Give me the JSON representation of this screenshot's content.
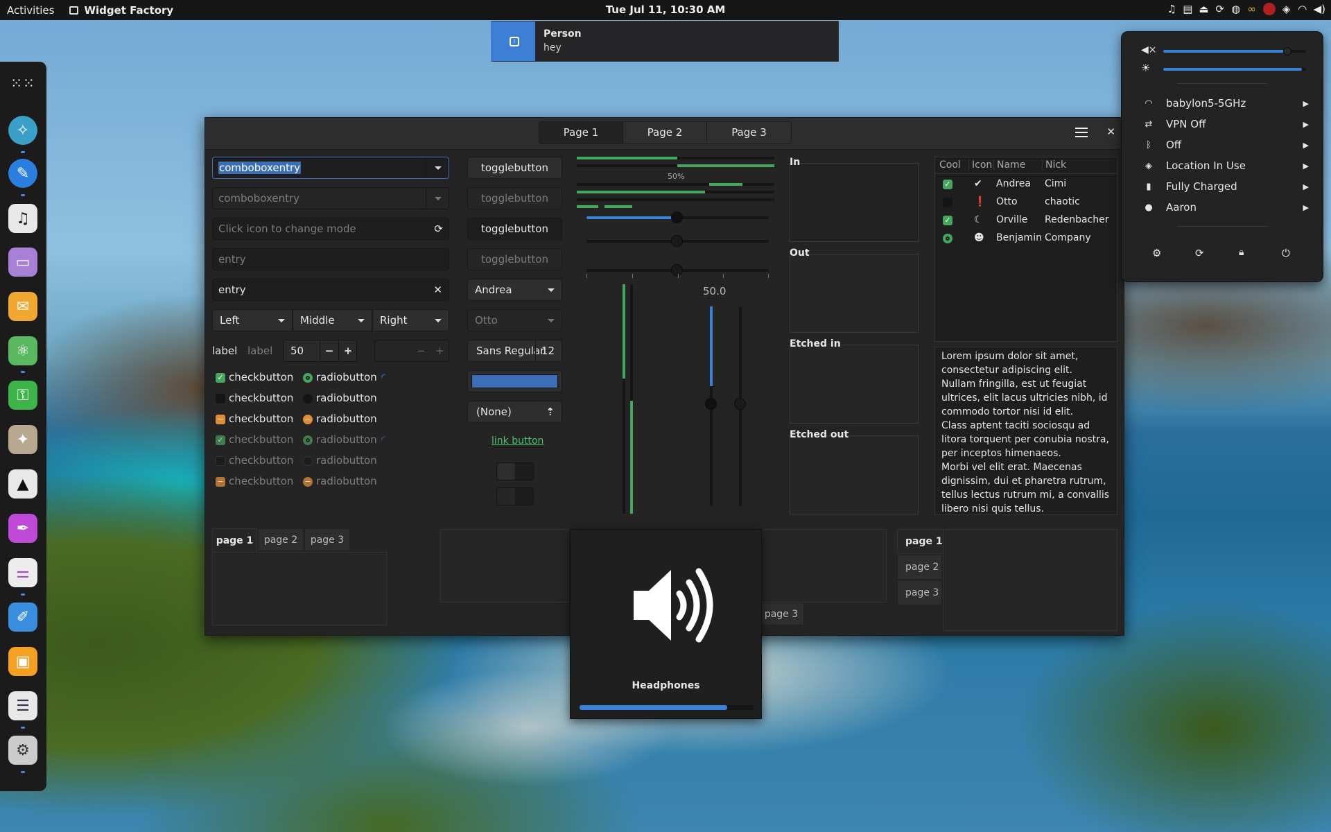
{
  "topbar": {
    "activities": "Activities",
    "app_name": "Widget Factory",
    "clock": "Tue Jul 11, 10:30 AM",
    "tray_icons": [
      "music-icon",
      "clipboard-icon",
      "eject-icon",
      "refresh-icon",
      "steam-icon",
      "chain-icon",
      "avatar-icon",
      "location-icon",
      "wifi-icon",
      "volume-icon"
    ]
  },
  "notification": {
    "title": "Person",
    "body": "hey"
  },
  "header": {
    "pages": [
      "Page 1",
      "Page 2",
      "Page 3"
    ]
  },
  "entries": {
    "combo1": "comboboxentry",
    "combo2": "comboboxentry",
    "icon_placeholder": "Click icon to change mode",
    "entry1": "entry",
    "entry2": "entry",
    "combo_left": "Left",
    "combo_middle": "Middle",
    "combo_right": "Right",
    "label1": "label",
    "label2": "label",
    "spin_value": "50"
  },
  "checks": {
    "check_label": "checkbutton",
    "radio_label": "radiobutton"
  },
  "buttons": {
    "toggle": "togglebutton",
    "combo_andrea": "Andrea",
    "combo_otto": "Otto",
    "font_name": "Sans Regular",
    "font_size": "12",
    "file_none": "(None)",
    "link": "link button",
    "color_swatch": "#3a6fb7"
  },
  "progress": {
    "label": "50%",
    "scale_value": "50.0",
    "value": 0.5
  },
  "frames": {
    "in": "In",
    "out": "Out",
    "etched_in": "Etched in",
    "etched_out": "Etched out"
  },
  "tree": {
    "headers": [
      "Cool",
      "Icon",
      "Name",
      "Nick"
    ],
    "rows": [
      {
        "name": "Andrea",
        "nick": "Cimi",
        "icon": "check-circle-icon"
      },
      {
        "name": "Otto",
        "nick": "chaotic",
        "icon": "alert-icon"
      },
      {
        "name": "Orville",
        "nick": "Redenbacher",
        "icon": "moon-icon"
      },
      {
        "name": "Benjamin",
        "nick": "Company",
        "icon": "face-icon"
      }
    ]
  },
  "textview": "Lorem ipsum dolor sit amet, consectetur adipiscing elit.\nNullam fringilla, est ut feugiat ultrices, elit lacus ultricies nibh, id commodo tortor nisi id elit.\nClass aptent taciti sociosqu ad litora torquent per conubia nostra, per inceptos himenaeos.\nMorbi vel elit erat. Maecenas dignissim, dui et pharetra rutrum, tellus lectus rutrum mi, a convallis libero nisi quis tellus.",
  "notebooks": {
    "tabs": [
      "page 1",
      "page 2",
      "page 3"
    ]
  },
  "osd": {
    "label": "Headphones",
    "level": 0.85
  },
  "system_menu": {
    "volume": 0.87,
    "brightness": 0.97,
    "items": [
      "babylon5-5GHz",
      "VPN Off",
      "Off",
      "Location In Use",
      "Fully Charged",
      "Aaron"
    ],
    "item_icons": [
      "wifi-icon",
      "vpn-icon",
      "bluetooth-icon",
      "location-icon",
      "battery-icon",
      "user-icon"
    ],
    "action_icons": [
      "settings-icon",
      "refresh-icon",
      "lock-icon",
      "power-icon"
    ]
  }
}
